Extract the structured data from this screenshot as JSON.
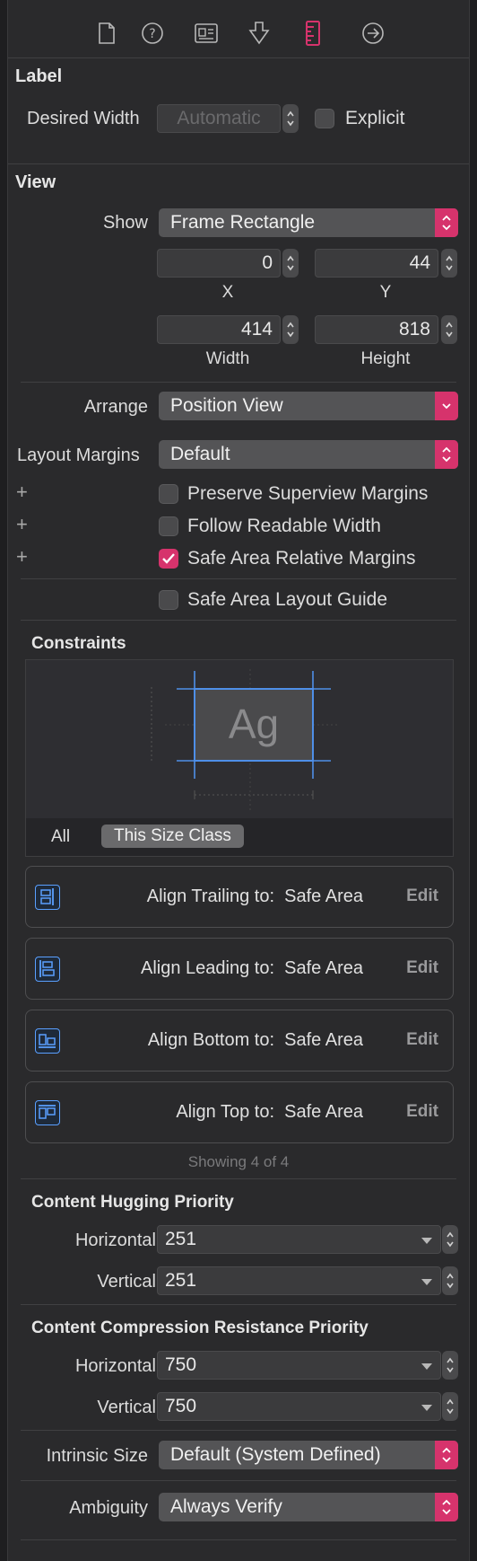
{
  "toolbar": {
    "icons": [
      "file-icon",
      "help-icon",
      "identity-icon",
      "attributes-icon",
      "size-ruler-icon",
      "connections-icon"
    ],
    "active_icon": "size-ruler-icon",
    "accent_color": "#d6336c"
  },
  "label_section": {
    "title": "Label",
    "desired_width_label": "Desired Width",
    "desired_width_placeholder": "Automatic",
    "explicit_label": "Explicit"
  },
  "view_section": {
    "title": "View",
    "show_label": "Show",
    "show_value": "Frame Rectangle",
    "x_value": "0",
    "x_caption": "X",
    "y_value": "44",
    "y_caption": "Y",
    "width_value": "414",
    "width_caption": "Width",
    "height_value": "818",
    "height_caption": "Height",
    "arrange_label": "Arrange",
    "arrange_value": "Position View",
    "layout_margins_label": "Layout Margins",
    "layout_margins_value": "Default",
    "preserve_superview": "Preserve Superview Margins",
    "follow_readable": "Follow Readable Width",
    "safe_area_relative": "Safe Area Relative Margins",
    "safe_area_guide": "Safe Area Layout Guide",
    "plus": "+"
  },
  "constraints": {
    "title": "Constraints",
    "preview_text": "Ag",
    "tab_all": "All",
    "tab_size_class": "This Size Class",
    "items": [
      {
        "label": "Align Trailing to:",
        "target": "Safe Area",
        "edit": "Edit"
      },
      {
        "label": "Align Leading to:",
        "target": "Safe Area",
        "edit": "Edit"
      },
      {
        "label": "Align Bottom to:",
        "target": "Safe Area",
        "edit": "Edit"
      },
      {
        "label": "Align Top to:",
        "target": "Safe Area",
        "edit": "Edit"
      }
    ],
    "showing": "Showing 4 of 4"
  },
  "hugging": {
    "title": "Content Hugging Priority",
    "horizontal_label": "Horizontal",
    "horizontal_value": "251",
    "vertical_label": "Vertical",
    "vertical_value": "251"
  },
  "compression": {
    "title": "Content Compression Resistance Priority",
    "horizontal_label": "Horizontal",
    "horizontal_value": "750",
    "vertical_label": "Vertical",
    "vertical_value": "750"
  },
  "intrinsic": {
    "label": "Intrinsic Size",
    "value": "Default (System Defined)"
  },
  "ambiguity": {
    "label": "Ambiguity",
    "value": "Always Verify"
  }
}
